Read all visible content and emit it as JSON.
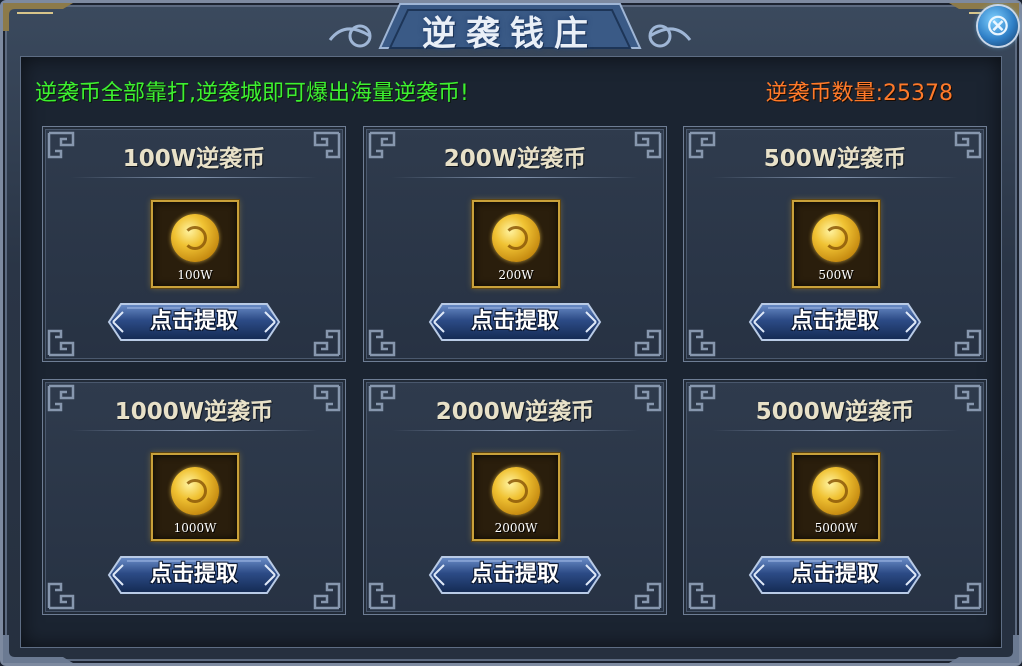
{
  "window": {
    "title": "逆袭钱庄",
    "close_icon": "close-icon"
  },
  "notice": "逆袭币全部靠打,逆袭城即可爆出海量逆袭币!",
  "coin_count_label": "逆袭币数量:25378",
  "colors": {
    "notice": "#3df030",
    "count": "#ff7a2a",
    "coin_gold": "#f0c233"
  },
  "cards": [
    {
      "title": "100W逆袭币",
      "coin_label": "100W",
      "button": "点击提取",
      "icon": "gold-coin-icon"
    },
    {
      "title": "200W逆袭币",
      "coin_label": "200W",
      "button": "点击提取",
      "icon": "gold-coin-icon"
    },
    {
      "title": "500W逆袭币",
      "coin_label": "500W",
      "button": "点击提取",
      "icon": "gold-coin-icon"
    },
    {
      "title": "1000W逆袭币",
      "coin_label": "1000W",
      "button": "点击提取",
      "icon": "gold-coin-icon"
    },
    {
      "title": "2000W逆袭币",
      "coin_label": "2000W",
      "button": "点击提取",
      "icon": "gold-coin-icon"
    },
    {
      "title": "5000W逆袭币",
      "coin_label": "5000W",
      "button": "点击提取",
      "icon": "gold-coin-icon"
    }
  ]
}
